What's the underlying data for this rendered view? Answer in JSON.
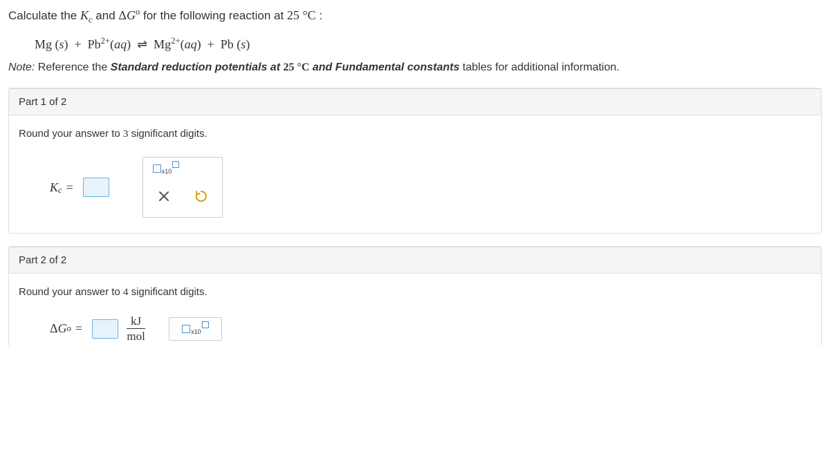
{
  "prompt": {
    "lead": "Calculate the ",
    "and": " and ",
    "tail": " for the following reaction at ",
    "temp": "25 °C",
    "colon": ":"
  },
  "equation": "Mg (s) + Pb²⁺(aq) ⇌ Mg²⁺(aq) + Pb (s)",
  "note": {
    "label": "Note:",
    "pre": " Reference the ",
    "ref1": "Standard reduction potentials at ",
    "temp": "25 °C",
    "and": " and ",
    "ref2": "Fundamental constants",
    "post": " tables for additional information."
  },
  "part1": {
    "header": "Part 1 of 2",
    "instruction_pre": "Round your answer to ",
    "sigdigits": "3",
    "instruction_post": " significant digits.",
    "label_K": "K",
    "label_sub": "c",
    "equals": " = ",
    "sci_x10": "x10"
  },
  "part2": {
    "header": "Part 2 of 2",
    "instruction_pre": "Round your answer to ",
    "sigdigits": "4",
    "instruction_post": " significant digits.",
    "label_delta": "Δ",
    "label_G": "G",
    "label_sup": "o",
    "equals": " = ",
    "unit_top": "kJ",
    "unit_bot": "mol",
    "sci_x10": "x10"
  }
}
